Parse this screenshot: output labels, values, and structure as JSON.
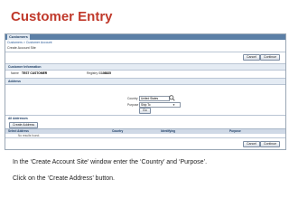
{
  "slide_title": "Customer Entry",
  "app": {
    "tab_label": "Customers",
    "breadcrumb": "Customers  >  Customer Account",
    "page_header": "Create Account Site",
    "top_buttons": [
      "Cancel",
      "Continue"
    ],
    "customer_info": {
      "section_label": "Customer Information",
      "name_label": "Name",
      "name_value": "TEST CUSTOMER",
      "registry_label": "Registry ID",
      "registry_value": "108825"
    },
    "address": {
      "section_label": "Address",
      "country_label": "Country",
      "country_value": "United States",
      "purpose_label": "Purpose",
      "purpose_value": "Ship To",
      "go_label": "Go"
    },
    "all_addresses": {
      "section_label": "All Addresses",
      "create_button": "Create Address",
      "columns": [
        "Select Address",
        "Country",
        "Identifying",
        "Purpose"
      ],
      "empty_text": "No results found."
    },
    "bottom_buttons": [
      "Cancel",
      "Continue"
    ]
  },
  "instructions": {
    "line1": "In the ‘Create Account Site’ window enter the ‘Country’ and ‘Purpose’.",
    "line2": "Click on the ‘Create Address’ button."
  },
  "colors": {
    "title": "#c0392b",
    "tabbar": "#5b7fa6",
    "section_bar": "#e4ebf3"
  }
}
